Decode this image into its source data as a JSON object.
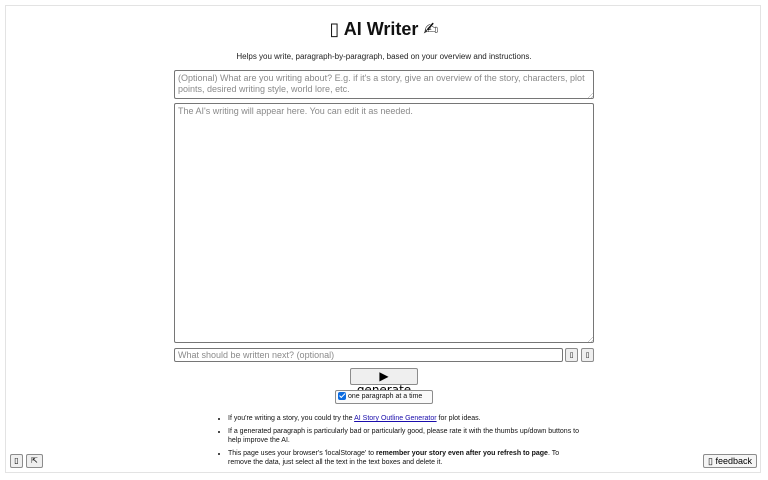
{
  "header": {
    "title_prefix_icon": "▯",
    "title": "AI Writer",
    "title_suffix_icon": "✍",
    "subtitle": "Helps you write, paragraph-by-paragraph, based on your overview and instructions."
  },
  "overview": {
    "placeholder": "(Optional) What are you writing about? E.g. if it's a story, give an overview of the story, characters, plot points, desired writing style, world lore, etc.",
    "value": ""
  },
  "output": {
    "placeholder": "The AI's writing will appear here. You can edit it as needed.",
    "value": ""
  },
  "instruction": {
    "placeholder": "What should be written next? (optional)",
    "value": ""
  },
  "rating": {
    "thumbs_up_glyph": "▯",
    "thumbs_down_glyph": "▯"
  },
  "actions": {
    "generate_label": "▶ generate",
    "one_paragraph_label": "one paragraph at a time",
    "one_paragraph_checked": true
  },
  "tips": {
    "tip1_before": "If you're writing a story, you could try the ",
    "tip1_link": "AI Story Outline Generator",
    "tip1_after": " for plot ideas.",
    "tip2": "If a generated paragraph is particularly bad or particularly good, please rate it with the thumbs up/down buttons to help improve the AI.",
    "tip3_before": "This page uses your browser's 'localStorage' to ",
    "tip3_bold": "remember your story even after you refresh to page",
    "tip3_after": ". To remove the data, just select all the text in the text boxes and delete it."
  },
  "corner": {
    "left_button_1": "▯",
    "left_button_2": "⇱",
    "feedback_icon": "▯",
    "feedback_label": "feedback"
  }
}
